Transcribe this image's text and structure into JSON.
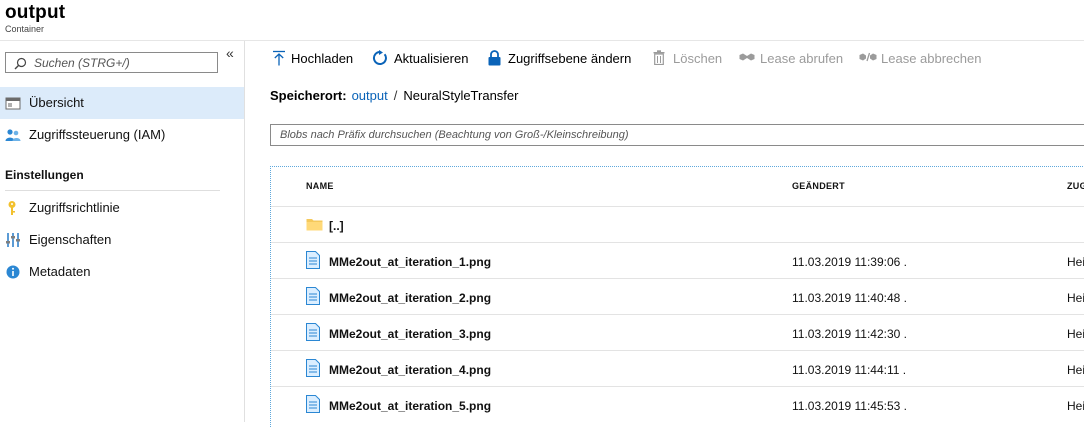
{
  "header": {
    "title": "output",
    "subtitle": "Container"
  },
  "sidebar": {
    "search_placeholder": "Suchen (STRG+/)",
    "collapse_glyph": "«",
    "items": [
      {
        "label": "Übersicht",
        "icon": "overview-icon",
        "active": true
      },
      {
        "label": "Zugriffssteuerung (IAM)",
        "icon": "users-icon",
        "active": false
      }
    ],
    "section_label": "Einstellungen",
    "settings_items": [
      {
        "label": "Zugriffsrichtlinie",
        "icon": "key-icon"
      },
      {
        "label": "Eigenschaften",
        "icon": "properties-icon"
      },
      {
        "label": "Metadaten",
        "icon": "info-icon"
      }
    ]
  },
  "toolbar": {
    "upload": "Hochladen",
    "refresh": "Aktualisieren",
    "access_level": "Zugriffsebene ändern",
    "delete": "Löschen",
    "lease_acquire": "Lease abrufen",
    "lease_break": "Lease abbrechen"
  },
  "location": {
    "label": "Speicherort:",
    "container": "output",
    "separator": "/",
    "folder": "NeuralStyleTransfer"
  },
  "filter_placeholder": "Blobs nach Präfix durchsuchen (Beachtung von Groß-/Kleinschreibung)",
  "table": {
    "columns": [
      "NAME",
      "GEÄNDERT",
      "ZUG"
    ],
    "parent_folder": "[..]",
    "rows": [
      {
        "name": "MMe2out_at_iteration_1.png",
        "modified": "11.03.2019 11:39:06 .",
        "access": "Hei"
      },
      {
        "name": "MMe2out_at_iteration_2.png",
        "modified": "11.03.2019 11:40:48 .",
        "access": "Hei"
      },
      {
        "name": "MMe2out_at_iteration_3.png",
        "modified": "11.03.2019 11:42:30 .",
        "access": "Hei"
      },
      {
        "name": "MMe2out_at_iteration_4.png",
        "modified": "11.03.2019 11:44:11 .",
        "access": "Hei"
      },
      {
        "name": "MMe2out_at_iteration_5.png",
        "modified": "11.03.2019 11:45:53 .",
        "access": "Hei"
      }
    ]
  },
  "colors": {
    "accent": "#0a63b8",
    "active_nav": "#dcebfa",
    "folder": "#f5c95b",
    "disabled": "#9b9b9b"
  }
}
